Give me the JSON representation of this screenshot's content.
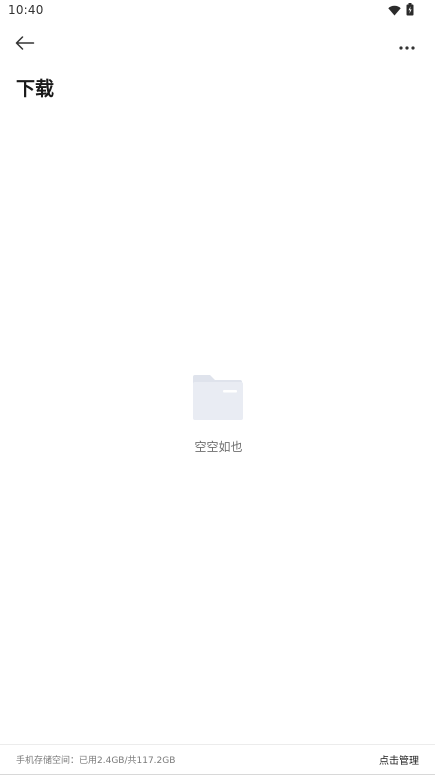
{
  "status_bar": {
    "time": "10:40",
    "icons": [
      "wifi-icon",
      "battery-icon"
    ]
  },
  "toolbar": {
    "back_icon": "arrow-left-icon",
    "more_icon": "more-horizontal-icon"
  },
  "page": {
    "title": "下载"
  },
  "empty_state": {
    "icon": "folder-icon",
    "message": "空空如也"
  },
  "footer": {
    "storage_label": "手机存储空间：已用2.4GB/共117.2GB",
    "manage_label": "点击管理"
  },
  "colors": {
    "background": "#ffffff",
    "title": "#1a1a1a",
    "muted_text": "#7a7a7a",
    "folder_light": "#e9ecf3",
    "folder_dark": "#dfe3ec"
  }
}
